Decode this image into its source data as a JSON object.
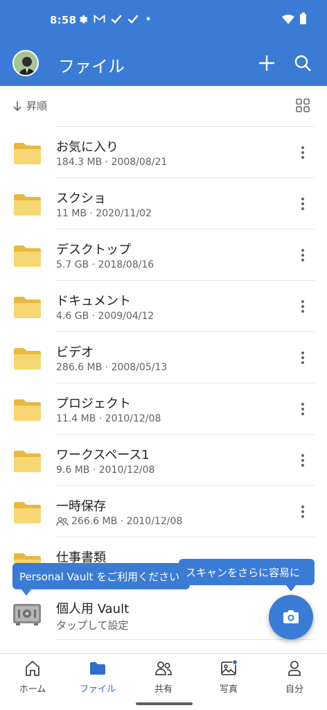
{
  "status": {
    "time": "8:58"
  },
  "header": {
    "title": "ファイル"
  },
  "sort": {
    "label": "昇順"
  },
  "files": [
    {
      "name": "お気に入り",
      "meta": "184.3 MB · 2008/08/21",
      "shared": false
    },
    {
      "name": "スクショ",
      "meta": "11 MB · 2020/11/02",
      "shared": false
    },
    {
      "name": "デスクトップ",
      "meta": "5.7 GB · 2018/08/16",
      "shared": false
    },
    {
      "name": "ドキュメント",
      "meta": "4.6 GB · 2009/04/12",
      "shared": false
    },
    {
      "name": "ビデオ",
      "meta": "286.6 MB · 2008/05/13",
      "shared": false
    },
    {
      "name": "プロジェクト",
      "meta": "11.4 MB · 2010/12/08",
      "shared": false
    },
    {
      "name": "ワークスペース1",
      "meta": "9.6 MB · 2010/12/08",
      "shared": false
    },
    {
      "name": "一時保存",
      "meta": "266.6 MB · 2010/12/08",
      "shared": true
    },
    {
      "name": "仕事書類",
      "meta": "",
      "shared": false
    }
  ],
  "vault": {
    "name": "個人用 Vault",
    "meta": "タップして設定"
  },
  "tooltips": {
    "vault": "Personal Vault をご利用ください",
    "scan": "スキャンをさらに容易に"
  },
  "nav": [
    {
      "label": "ホーム",
      "icon": "home-icon"
    },
    {
      "label": "ファイル",
      "icon": "folder-icon"
    },
    {
      "label": "共有",
      "icon": "people-icon"
    },
    {
      "label": "写真",
      "icon": "photo-icon"
    },
    {
      "label": "自分",
      "icon": "person-icon"
    }
  ],
  "colors": {
    "accent": "#3a7bd5",
    "folder": "#f5c84c",
    "active_nav": "#2f6fcb"
  }
}
